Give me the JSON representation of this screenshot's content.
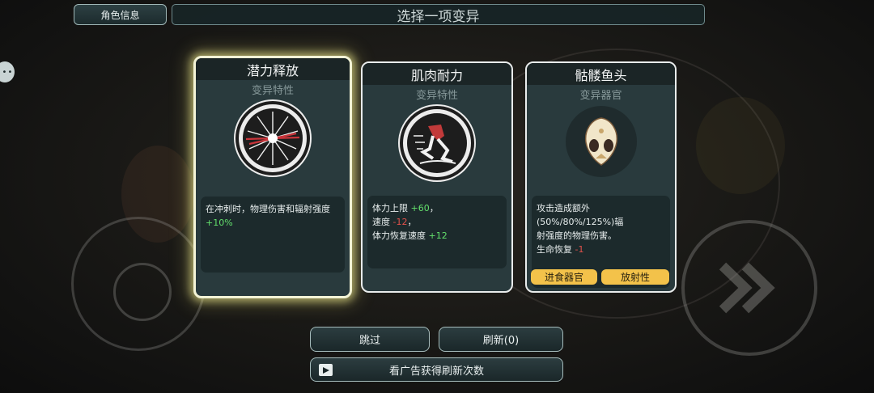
{
  "header": {
    "role_info_label": "角色信息",
    "title": "选择一项变异"
  },
  "cards": [
    {
      "title": "潜力释放",
      "type": "变异特性",
      "icon": "burst-icon",
      "selected": true,
      "desc_line1": "在冲刺时，物理伤害和辐射强度",
      "desc_bonus": "+10%"
    },
    {
      "title": "肌肉耐力",
      "type": "变异特性",
      "icon": "running-legs-icon",
      "selected": false,
      "stat1_label": "体力上限 ",
      "stat1_value": "+60",
      "stat1_suffix": "，",
      "stat2_label": "速度 ",
      "stat2_value": "-12",
      "stat2_suffix": "，",
      "stat3_label": "体力恢复速度 ",
      "stat3_value": "+12"
    },
    {
      "title": "骷髅鱼头",
      "type": "变异器官",
      "icon": "fish-skull-icon",
      "selected": false,
      "desc_line1": "攻击造成额外(50%/80%/125%)辐",
      "desc_line2": "射强度的物理伤害。",
      "desc_line3_label": "生命恢复 ",
      "desc_line3_value": "-1",
      "tags": [
        "进食器官",
        "放射性"
      ]
    }
  ],
  "buttons": {
    "skip": "跳过",
    "refresh": "刷新(0)",
    "watch_ad": "看广告获得刷新次数"
  },
  "colors": {
    "positive": "#63e06c",
    "negative": "#e2514b",
    "tag": "#f3c24a",
    "selected_glow": "#f3f3a0"
  }
}
